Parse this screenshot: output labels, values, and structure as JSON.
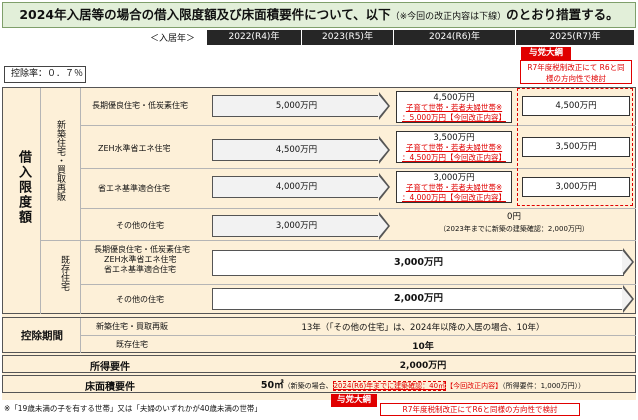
{
  "title": {
    "main": "2024年入居等の場合の借入限度額及び床面積要件について、以下",
    "note": "（※今回の改正内容は下線）",
    "tail": "のとおり措置する。"
  },
  "year_label": "＜入居年＞",
  "years": [
    "2022(R4)年",
    "2023(R5)年",
    "2024(R6)年",
    "2025(R7)年"
  ],
  "deduction_rate": "控除率：０．７％",
  "sections": {
    "borrow_limit": "借入限度額",
    "new_housing": "新築住宅・買取再販",
    "existing_housing": "既存住宅",
    "deduction_period": "控除期間",
    "income_req": "所得要件",
    "floor_req": "床面積要件"
  },
  "rows": {
    "long_term": "長期優良住宅・低炭素住宅",
    "zeh": "ZEH水準省エネ住宅",
    "energy_std": "省エネ基準適合住宅",
    "other": "その他の住宅",
    "existing_list": [
      "長期優良住宅・低炭素住宅",
      "ZEH水準省エネ住宅",
      "省エネ基準適合住宅"
    ],
    "existing_other": "その他の住宅",
    "period_new": "新築住宅・買取再販",
    "period_existing": "既存住宅"
  },
  "values": {
    "long_term_2223": "5,000万円",
    "zeh_2223": "4,500万円",
    "energy_2223": "4,000万円",
    "other_2223": "3,000万円",
    "long_term_2024": "4,500万円",
    "long_term_2024_child": "子育て世帯・若者夫婦世帯※",
    "long_term_2024_child_val": "：5,000万円【今回改正内容】",
    "zeh_2024": "3,500万円",
    "zeh_2024_child": "子育て世帯・若者夫婦世帯※",
    "zeh_2024_child_val": "：4,500万円【今回改正内容】",
    "energy_2024": "3,000万円",
    "energy_2024_child": "子育て世帯・若者夫婦世帯※",
    "energy_2024_child_val": "：4,000万円【今回改正内容】",
    "long_term_2025": "4,500万円",
    "zeh_2025": "3,500万円",
    "energy_2025": "3,000万円",
    "other_2024": "0円",
    "other_2024_note": "（2023年までに新築の建築確認：2,000万円）",
    "existing_val": "3,000万円",
    "existing_other_val": "2,000万円",
    "period_new_val": "13年（「その他の住宅」は、2024年以降の入居の場合、10年）",
    "period_existing_val": "10年",
    "income_val": "2,000万円",
    "floor_val": "50㎡",
    "floor_note": "（新築の場合、",
    "floor_underline": "2024(R6)年までに建築確認：40㎡",
    "floor_revision": "【今回改正内容】",
    "floor_income": "（所得要件：1,000万円））"
  },
  "ruling_party": {
    "tag": "与党大綱",
    "top_note": "R7年度税制改正にて R6と同様の方向性で検討",
    "bottom_note": "R7年度税制改正にてR6と同様の方向性で検討"
  },
  "footnote": "※「19歳未満の子を有する世帯」又は「夫婦のいずれかが40歳未満の世帯」",
  "colors": {
    "header_bg": "#262626",
    "title_bg": "#e2efd9",
    "grid_bg": "#fdf0d8",
    "accent_red": "#e00000"
  }
}
